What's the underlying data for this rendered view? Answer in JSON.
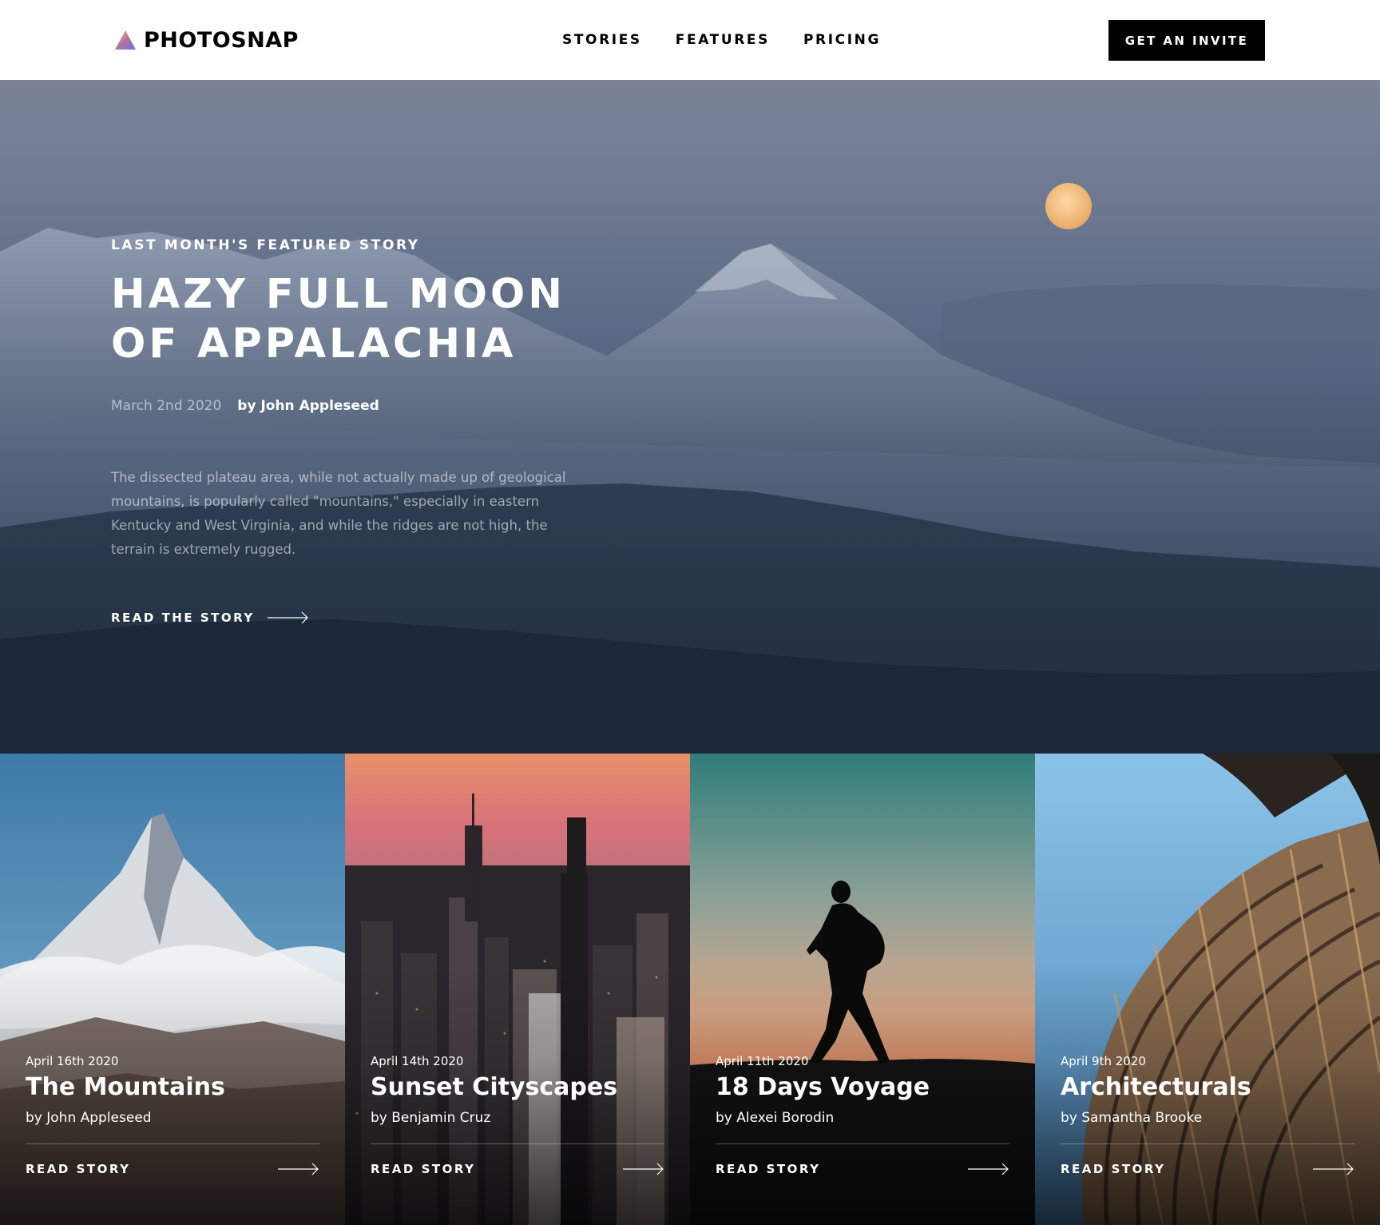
{
  "header": {
    "brand": "PHOTOSNAP",
    "nav": [
      "STORIES",
      "FEATURES",
      "PRICING"
    ],
    "cta_label": "GET AN INVITE"
  },
  "hero": {
    "eyebrow": "LAST MONTH'S FEATURED STORY",
    "title": "HAZY FULL MOON OF APPALACHIA",
    "date": "March 2nd 2020",
    "author": "by John Appleseed",
    "description": "The dissected plateau area, while not actually made up of geological mountains, is popularly called \"mountains,\" especially in eastern Kentucky and West Virginia, and while the ridges are not high, the terrain is extremely rugged.",
    "link_label": "READ THE STORY"
  },
  "cards": [
    {
      "date": "April 16th 2020",
      "title": "The Mountains",
      "author": "by John Appleseed",
      "link_label": "READ STORY"
    },
    {
      "date": "April 14th 2020",
      "title": "Sunset Cityscapes",
      "author": "by Benjamin Cruz",
      "link_label": "READ STORY"
    },
    {
      "date": "April 11th 2020",
      "title": "18 Days Voyage",
      "author": "by Alexei Borodin",
      "link_label": "READ STORY"
    },
    {
      "date": "April 9th 2020",
      "title": "Architecturals",
      "author": "by Samantha Brooke",
      "link_label": "READ STORY"
    }
  ],
  "colors": {
    "black": "#000000",
    "white": "#FFFFFF",
    "logo_gradient": [
      "#FFC593",
      "#BC7198",
      "#5A77FF"
    ]
  },
  "icons": [
    "logo-triangle-icon",
    "arrow-right-icon"
  ]
}
